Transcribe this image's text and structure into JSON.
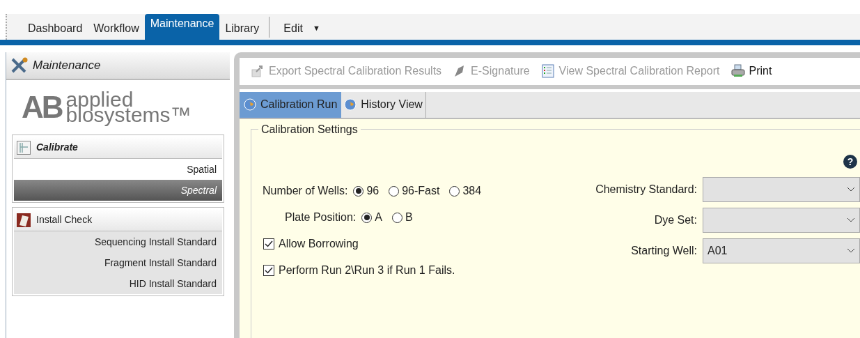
{
  "menu_tabs": [
    {
      "label": "Dashboard",
      "selected": false
    },
    {
      "label": "Workflow",
      "selected": false
    },
    {
      "label": "Maintenance",
      "selected": true
    },
    {
      "label": "Library",
      "selected": false
    }
  ],
  "edit_menu": {
    "label": "Edit",
    "caret": "▼"
  },
  "sidebar": {
    "title": "Maintenance",
    "logo": {
      "mark": "AB",
      "line1": "applied",
      "line2": "biosystems™"
    },
    "sections": [
      {
        "title": "Calibrate",
        "kind": "calibrate",
        "items": [
          {
            "label": "Spatial",
            "selected": false
          },
          {
            "label": "Spectral",
            "selected": true
          }
        ]
      },
      {
        "title": "Install Check",
        "kind": "install",
        "items": [
          {
            "label": "Sequencing Install Standard",
            "selected": false
          },
          {
            "label": "Fragment Install Standard",
            "selected": false
          },
          {
            "label": "HID Install Standard",
            "selected": false
          }
        ]
      }
    ]
  },
  "toolbar": [
    {
      "label": "Export Spectral Calibration Results",
      "kind": "export",
      "disabled": true
    },
    {
      "label": "E-Signature",
      "kind": "signature",
      "disabled": true
    },
    {
      "label": "View Spectral Calibration Report",
      "kind": "report",
      "disabled": true
    },
    {
      "label": "Print",
      "kind": "print",
      "disabled": false
    }
  ],
  "view_tabs": [
    {
      "label": "Calibration Run",
      "selected": true
    },
    {
      "label": "History View",
      "selected": false
    }
  ],
  "settings": {
    "title": "Calibration Settings",
    "number_of_wells": {
      "label": "Number of Wells:",
      "options": [
        {
          "label": "96",
          "selected": true
        },
        {
          "label": "96-Fast",
          "selected": false
        },
        {
          "label": "384",
          "selected": false
        }
      ]
    },
    "plate_position": {
      "label": "Plate Position:",
      "options": [
        {
          "label": "A",
          "selected": true
        },
        {
          "label": "B",
          "selected": false
        }
      ]
    },
    "checkboxes": [
      {
        "label": "Allow Borrowing",
        "checked": true
      },
      {
        "label": "Perform Run 2\\Run 3 if Run 1 Fails.",
        "checked": true
      }
    ],
    "help": "?",
    "dropdowns": [
      {
        "label": "Chemistry Standard:"
      },
      {
        "label": "Dye Set:"
      },
      {
        "label": "Starting Well:",
        "value": "A01"
      }
    ]
  }
}
